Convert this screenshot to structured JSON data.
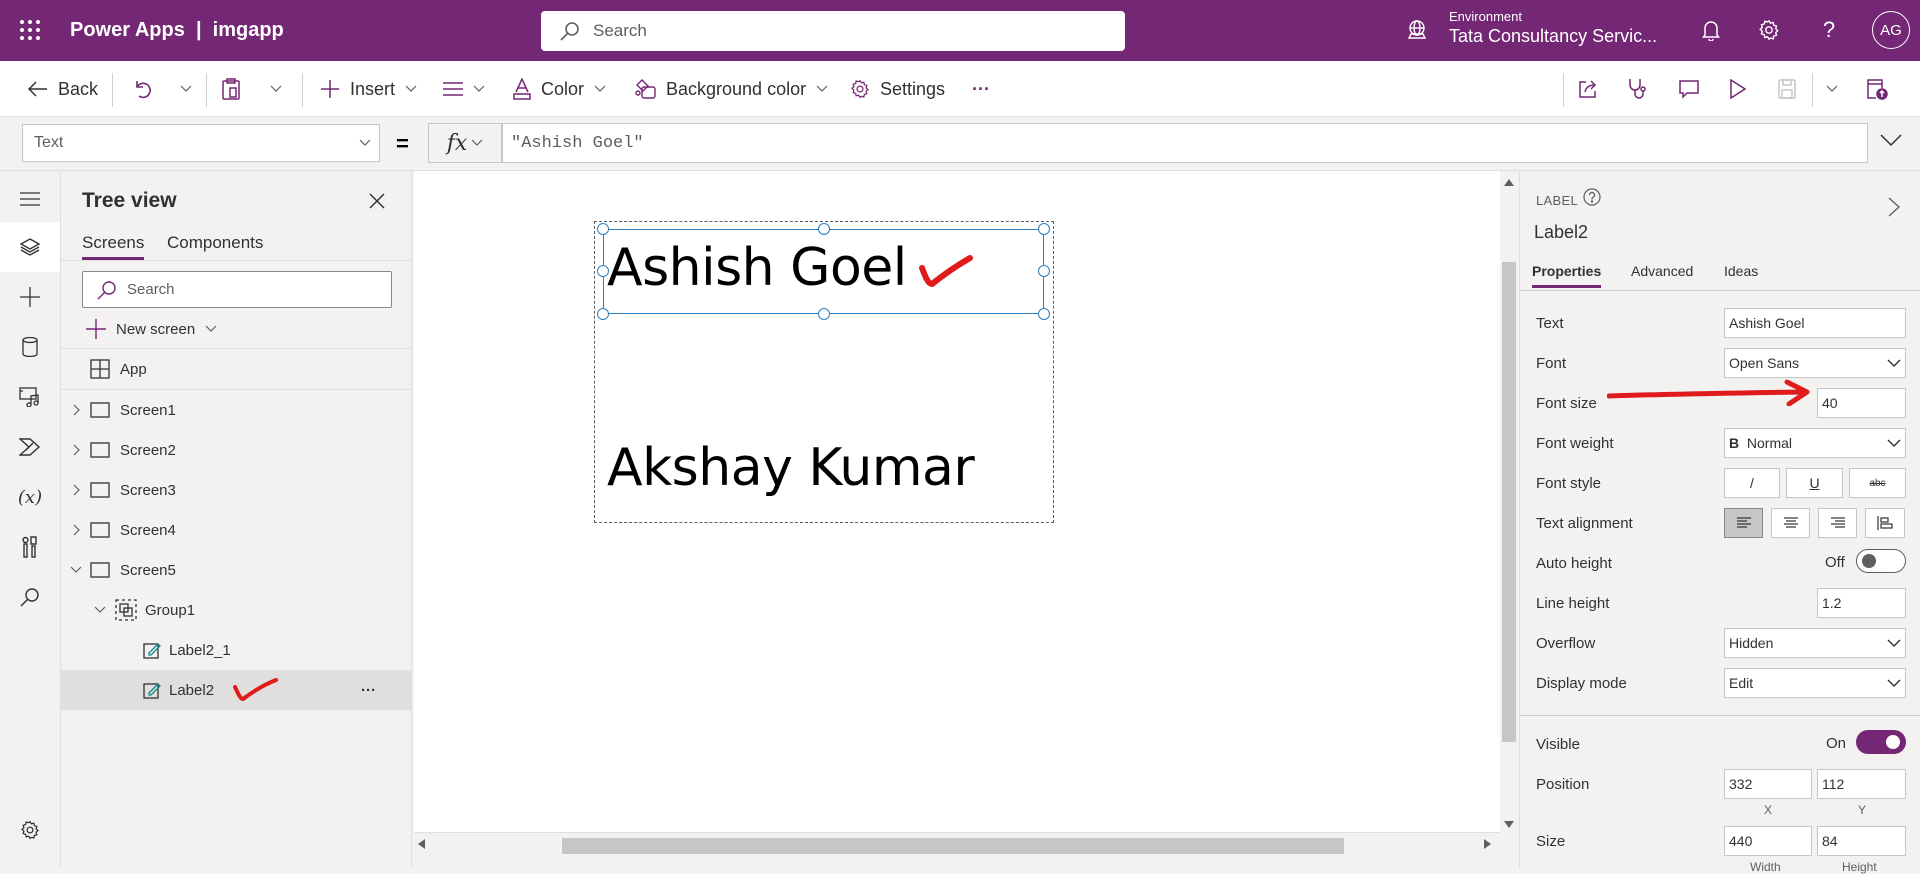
{
  "header": {
    "app_title": "Power Apps  |  imgapp",
    "search_placeholder": "Search",
    "environment_label": "Environment",
    "environment_name": "Tata Consultancy Servic...",
    "avatar_initials": "AG",
    "help_glyph": "?"
  },
  "toolbar": {
    "back": "Back",
    "insert": "Insert",
    "color": "Color",
    "background_color": "Background color",
    "settings": "Settings",
    "more": "···"
  },
  "formula_bar": {
    "property": "Text",
    "equals": "=",
    "fx": "fx",
    "formula": "\"Ashish Goel\""
  },
  "tree_view": {
    "title": "Tree view",
    "tabs": [
      "Screens",
      "Components"
    ],
    "active_tab": "Screens",
    "search_placeholder": "Search",
    "new_screen": "New screen",
    "app_item": "App",
    "items": [
      {
        "label": "Screen1",
        "type": "screen",
        "expanded": false
      },
      {
        "label": "Screen2",
        "type": "screen",
        "expanded": false
      },
      {
        "label": "Screen3",
        "type": "screen",
        "expanded": false
      },
      {
        "label": "Screen4",
        "type": "screen",
        "expanded": false
      },
      {
        "label": "Screen5",
        "type": "screen",
        "expanded": true
      },
      {
        "label": "Group1",
        "type": "group",
        "expanded": true
      },
      {
        "label": "Label2_1",
        "type": "label"
      },
      {
        "label": "Label2",
        "type": "label",
        "selected": true
      }
    ],
    "row_more": "···"
  },
  "canvas": {
    "labels": [
      "Ashish Goel",
      "Akshay Kumar"
    ],
    "annotation_color": "#e01b1b"
  },
  "properties": {
    "control_type": "LABEL",
    "control_name": "Label2",
    "tabs": [
      "Properties",
      "Advanced",
      "Ideas"
    ],
    "active_tab": "Properties",
    "rows": {
      "text": {
        "label": "Text",
        "value": "Ashish Goel"
      },
      "font": {
        "label": "Font",
        "value": "Open Sans"
      },
      "font_size": {
        "label": "Font size",
        "value": "40"
      },
      "font_weight": {
        "label": "Font weight",
        "value": "Normal",
        "icon": "B"
      },
      "font_style": {
        "label": "Font style",
        "italic": "/",
        "underline": "U",
        "strike": "abc"
      },
      "text_alignment": {
        "label": "Text alignment",
        "selected": "left"
      },
      "auto_height": {
        "label": "Auto height",
        "state": "Off"
      },
      "line_height": {
        "label": "Line height",
        "value": "1.2"
      },
      "overflow": {
        "label": "Overflow",
        "value": "Hidden"
      },
      "display_mode": {
        "label": "Display mode",
        "value": "Edit"
      },
      "visible": {
        "label": "Visible",
        "state": "On"
      },
      "position": {
        "label": "Position",
        "x": "332",
        "y": "112",
        "x_caption": "X",
        "y_caption": "Y"
      },
      "size": {
        "label": "Size",
        "width": "440",
        "height": "84",
        "width_caption": "Width",
        "height_caption": "Height"
      }
    }
  },
  "colors": {
    "brand": "#742774",
    "selection": "#2d7fc1",
    "annotation": "#e01b1b"
  }
}
